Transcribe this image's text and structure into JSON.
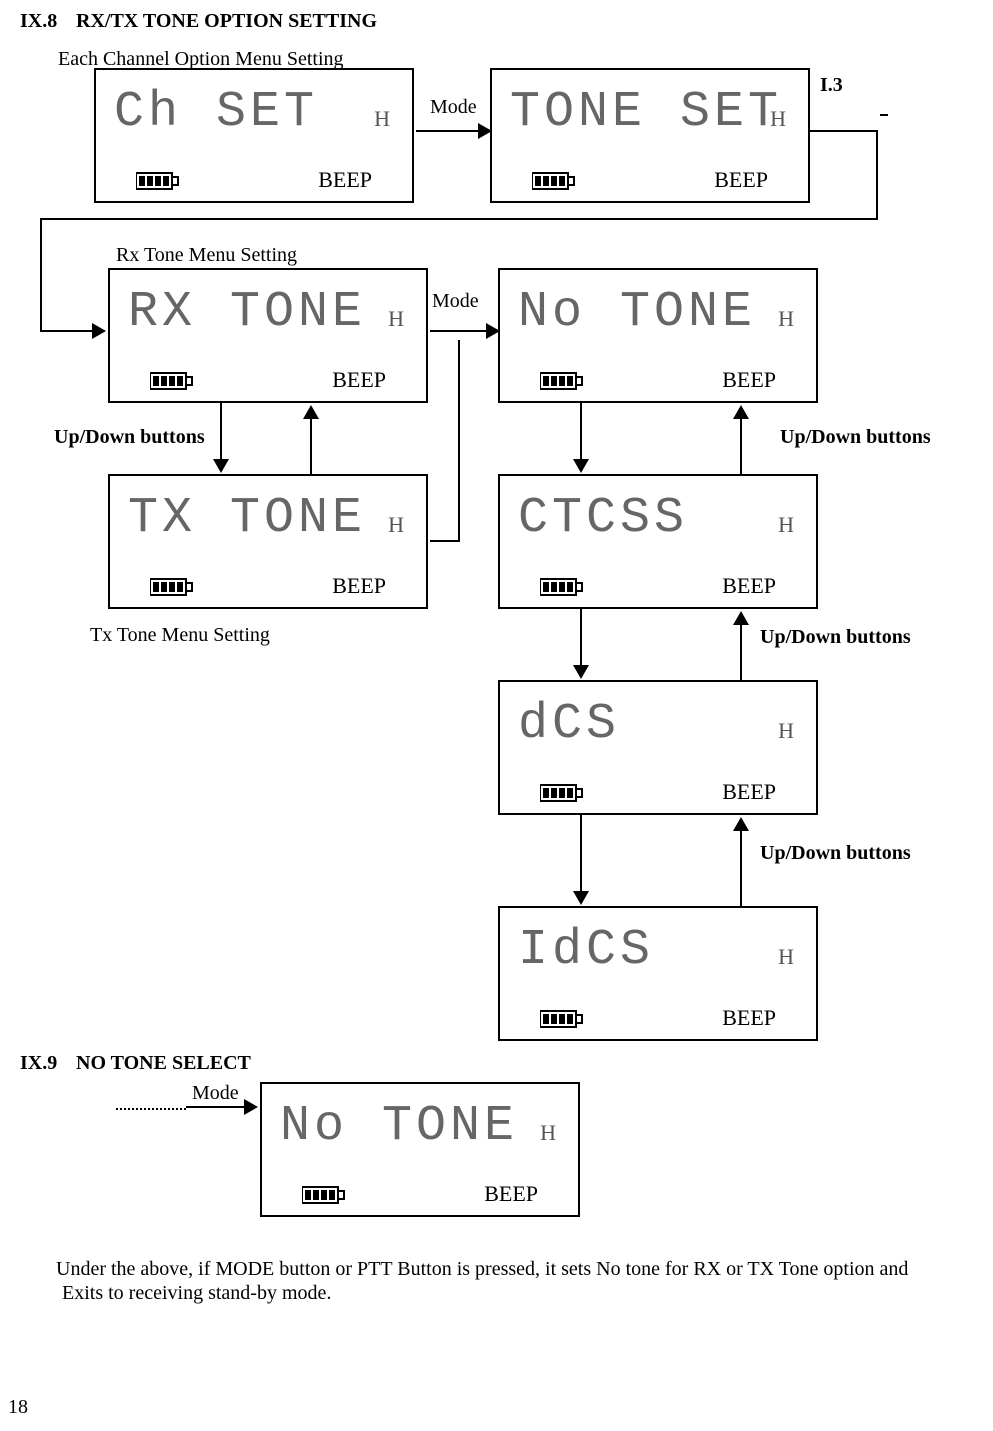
{
  "page_number": "18",
  "section_ix8": {
    "num": "IX.8",
    "title": "RX/TX TONE OPTION SETTING"
  },
  "section_ix9": {
    "num": "IX.9",
    "title": "NO TONE SELECT"
  },
  "labels": {
    "each_channel": "Each Channel Option Menu Setting",
    "rx_tone_menu": "Rx Tone Menu Setting",
    "tx_tone_menu": "Tx Tone Menu Setting",
    "updown": "Up/Down buttons",
    "mode": "Mode",
    "i3": "I.3"
  },
  "lcd": {
    "ch_set": {
      "text": "Ch  SET",
      "h": "H",
      "beep": "BEEP"
    },
    "tone_set": {
      "text": "TONE  SET",
      "h": "H",
      "beep": "BEEP"
    },
    "rx_tone": {
      "text": "RX  TONE",
      "h": "H",
      "beep": "BEEP"
    },
    "no_tone": {
      "text": "No  TONE",
      "h": "H",
      "beep": "BEEP"
    },
    "tx_tone": {
      "text": "TX  TONE",
      "h": "H",
      "beep": "BEEP"
    },
    "ctcss": {
      "text": "CTCSS",
      "h": "H",
      "beep": "BEEP"
    },
    "dcs": {
      "text": "dCS",
      "h": "H",
      "beep": "BEEP"
    },
    "idcs": {
      "text": "IdCS",
      "h": "H",
      "beep": "BEEP"
    },
    "no_tone2": {
      "text": "No  TONE",
      "h": "H",
      "beep": "BEEP"
    }
  },
  "body_text": {
    "line1": "Under the above, if MODE button or PTT Button is pressed, it sets No tone for RX or TX Tone option and",
    "line2": "Exits to receiving stand-by mode."
  }
}
